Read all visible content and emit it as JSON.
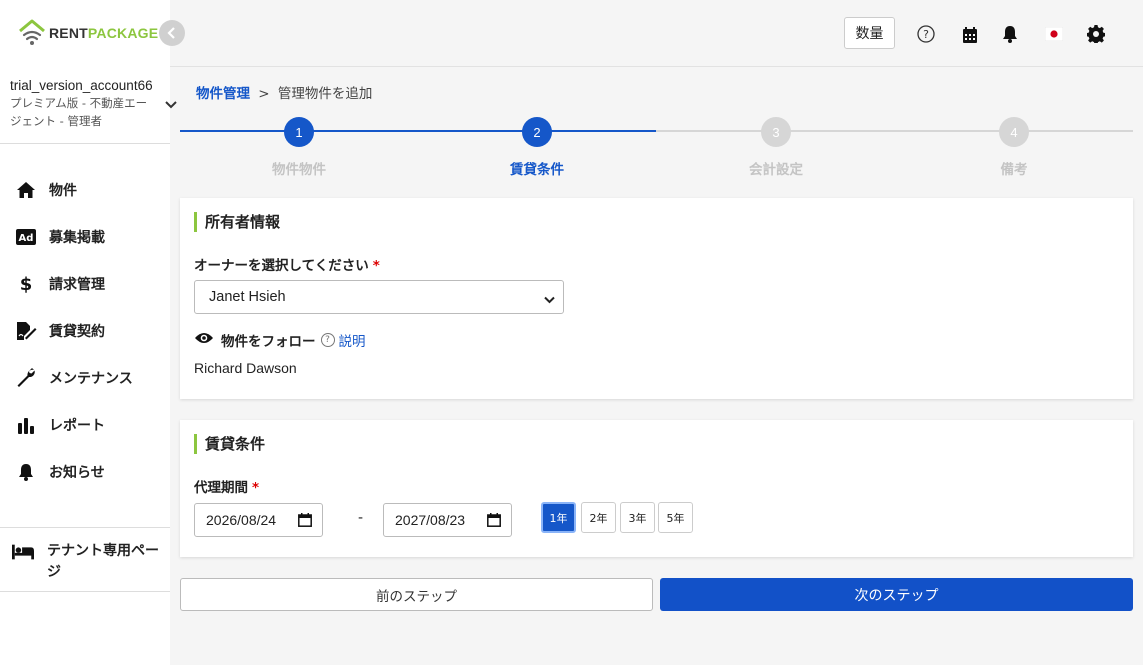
{
  "brand": {
    "rent": "RENT",
    "package": "PACKAGE",
    "accent": "#8cc63f",
    "primary": "#1251c8"
  },
  "account": {
    "name": "trial_version_account66",
    "plan": "プレミアム版 - 不動産エージェント - 管理者"
  },
  "nav": {
    "items": [
      {
        "icon": "home-icon",
        "label": "物件"
      },
      {
        "icon": "ad-icon",
        "label": "募集掲載"
      },
      {
        "icon": "dollar-icon",
        "label": "請求管理"
      },
      {
        "icon": "contract-icon",
        "label": "賃貸契約"
      },
      {
        "icon": "wrench-icon",
        "label": "メンテナンス"
      },
      {
        "icon": "chart-icon",
        "label": "レポート"
      },
      {
        "icon": "bell-icon",
        "label": "お知らせ"
      }
    ],
    "tenant_label": "テナント専用ページ"
  },
  "header": {
    "qty_label": "数量"
  },
  "breadcrumb": {
    "parent": "物件管理",
    "sep": ">",
    "current": "管理物件を追加"
  },
  "steps": [
    {
      "num": "1",
      "label": "物件物件",
      "state": "done"
    },
    {
      "num": "2",
      "label": "賃貸条件",
      "state": "active"
    },
    {
      "num": "3",
      "label": "会計設定",
      "state": "todo"
    },
    {
      "num": "4",
      "label": "備考",
      "state": "todo"
    }
  ],
  "owner_section": {
    "title": "所有者情報",
    "select_label": "オーナーを選択してください",
    "required_mark": "*",
    "selected_owner": "Janet Hsieh",
    "follow_label": "物件をフォロー",
    "help_label": "説明",
    "follower": "Richard Dawson"
  },
  "lease_section": {
    "title": "賃貸条件",
    "period_label": "代理期間",
    "required_mark": "*",
    "start_date": "2026/08/24",
    "dash": "-",
    "end_date": "2027/08/23",
    "year_options": [
      "1年",
      "2年",
      "3年",
      "5年"
    ],
    "selected_year": "1年"
  },
  "footer": {
    "prev_label": "前のステップ",
    "next_label": "次のステップ"
  }
}
